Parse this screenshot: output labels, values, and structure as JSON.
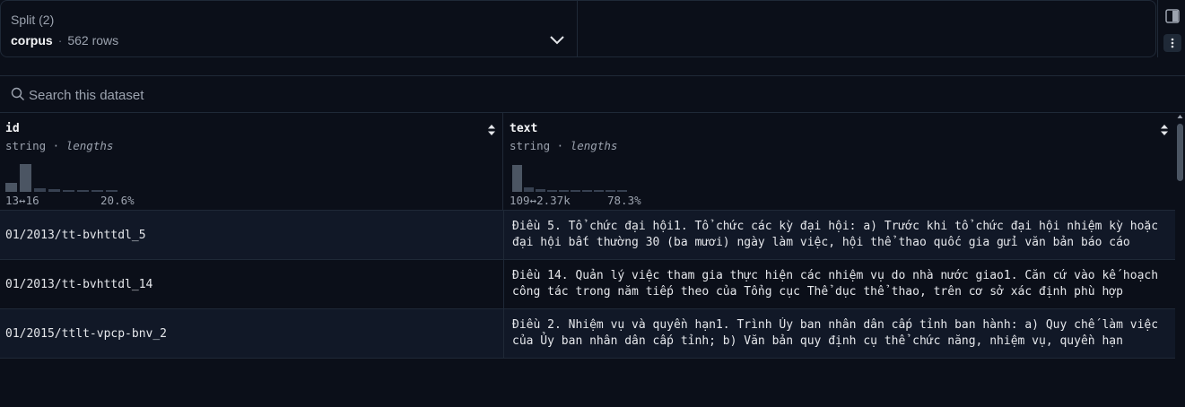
{
  "split": {
    "label": "Split (2)",
    "name": "corpus",
    "separator": "·",
    "rows": "562 rows"
  },
  "search": {
    "placeholder": "Search this dataset"
  },
  "columns": [
    {
      "name": "id",
      "type": "string",
      "sep": " · ",
      "stat": "lengths",
      "range": "13↔16",
      "pct": "20.6%"
    },
    {
      "name": "text",
      "type": "string",
      "sep": " · ",
      "stat": "lengths",
      "range": "109↔2.37k",
      "pct": "78.3%"
    }
  ],
  "rows": [
    {
      "id": "01/2013/tt-bvhttdl_5",
      "text": "Điều 5. Tổ chức đại hội1. Tổ chức các kỳ đại hội: a) Trước khi tổ chức đại hội nhiệm kỳ hoặc đại hội bất thường 30 (ba mươi) ngày làm việc, hội thể thao quốc gia gửi văn bản báo cáo"
    },
    {
      "id": "01/2013/tt-bvhttdl_14",
      "text": "Điều 14. Quản lý việc tham gia thực hiện các nhiệm vụ do nhà nước giao1. Căn cứ vào kế hoạch công tác trong năm tiếp theo của Tổng cục Thể dục thể thao, trên cơ sở xác định phù hợp"
    },
    {
      "id": "01/2015/ttlt-vpcp-bnv_2",
      "text": "Điều 2. Nhiệm vụ và quyền hạn1. Trình Ủy ban nhân dân cấp tỉnh ban hành: a) Quy chế làm việc của Ủy ban nhân dân cấp tỉnh; b) Văn bản quy định cụ thể chức năng, nhiệm vụ, quyền hạn"
    }
  ],
  "colors": {
    "background": "#0b0f19",
    "border": "#1f2937",
    "histogram_bar": "#4b5563"
  }
}
